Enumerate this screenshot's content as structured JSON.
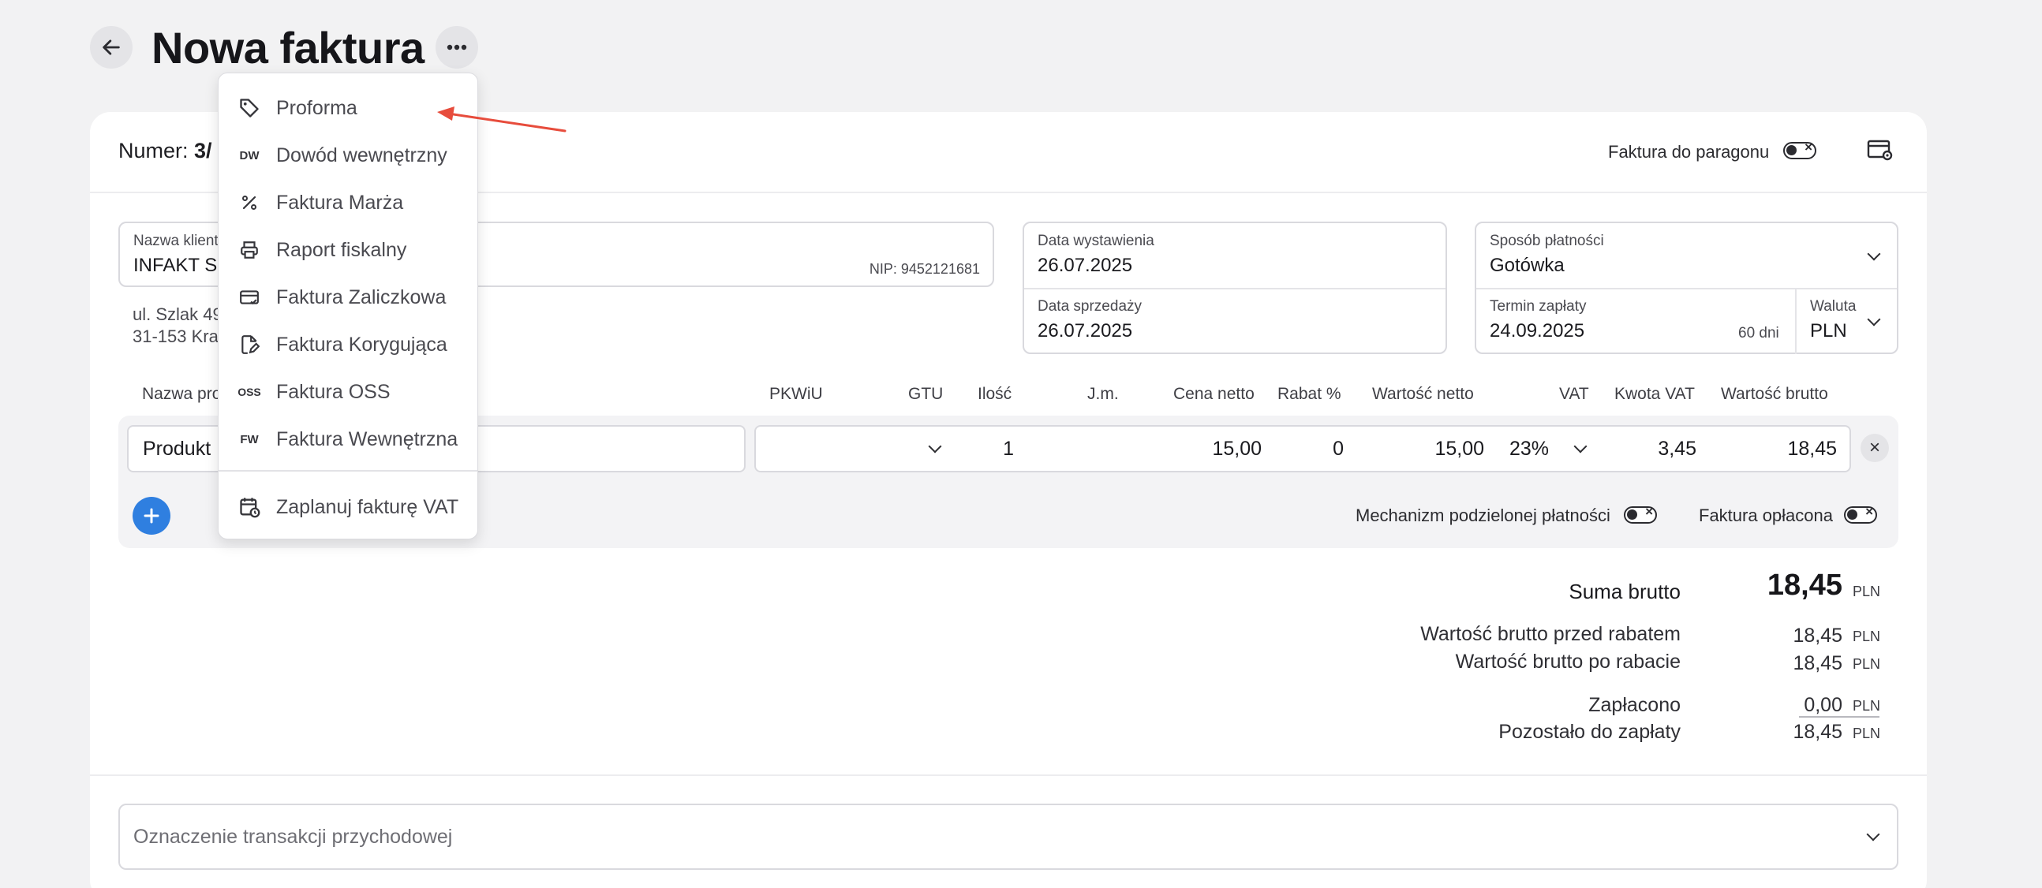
{
  "header": {
    "title": "Nowa faktura"
  },
  "card_head": {
    "numer_label": "Numer:",
    "numer_value": "3/",
    "receipt_toggle_label": "Faktura do paragonu"
  },
  "client": {
    "caption": "Nazwa klient",
    "name": "INFAKT S",
    "nip": "NIP: 9452121681",
    "address_line1": "ul. Szlak 49",
    "address_line2": "31-153 Krak"
  },
  "dates": {
    "issue_caption": "Data wystawienia",
    "issue_value": "26.07.2025",
    "sale_caption": "Data sprzedaży",
    "sale_value": "26.07.2025"
  },
  "payment": {
    "method_caption": "Sposób płatności",
    "method_value": "Gotówka",
    "due_caption": "Termin zapłaty",
    "due_value": "24.09.2025",
    "due_days": "60 dni",
    "currency_caption": "Waluta",
    "currency_value": "PLN"
  },
  "table": {
    "headers": {
      "name": "Nazwa pro",
      "pkwiu": "PKWiU",
      "gtu": "GTU",
      "qty": "Ilość",
      "unit": "J.m.",
      "net_price": "Cena netto",
      "discount": "Rabat %",
      "net_value": "Wartość netto",
      "vat": "VAT",
      "vat_amount": "Kwota VAT",
      "gross_value": "Wartość brutto"
    },
    "row": {
      "name": "Produkt",
      "pkwiu": "",
      "gtu": "",
      "qty": "1",
      "unit": "",
      "net_price": "15,00",
      "discount": "0",
      "net_value": "15,00",
      "vat": "23%",
      "vat_amount": "3,45",
      "gross_value": "18,45"
    },
    "split_payment_label": "Mechanizm podzielonej płatności",
    "paid_label": "Faktura opłacona"
  },
  "summary": {
    "gross_label": "Suma brutto",
    "gross_value": "18,45",
    "currency": "PLN",
    "before_discount_label": "Wartość brutto przed rabatem",
    "before_discount_value": "18,45",
    "after_discount_label": "Wartość brutto po rabacie",
    "after_discount_value": "18,45",
    "paid_label": "Zapłacono",
    "paid_value": "0,00",
    "remaining_label": "Pozostało do zapłaty",
    "remaining_value": "18,45"
  },
  "transaction_field": {
    "placeholder": "Oznaczenie transakcji przychodowej"
  },
  "menu": {
    "items": [
      {
        "label": "Proforma",
        "icon": "tag-icon"
      },
      {
        "label": "Dowód wewnętrzny",
        "icon": "DW"
      },
      {
        "label": "Faktura Marża",
        "icon": "percent-icon"
      },
      {
        "label": "Raport fiskalny",
        "icon": "printer-icon"
      },
      {
        "label": "Faktura Zaliczkowa",
        "icon": "card-check-icon"
      },
      {
        "label": "Faktura Korygująca",
        "icon": "file-edit-icon"
      },
      {
        "label": "Faktura OSS",
        "icon": "OSS"
      },
      {
        "label": "Faktura Wewnętrzna",
        "icon": "FW"
      },
      {
        "label": "Zaplanuj fakturę VAT",
        "icon": "calendar-clock-icon"
      }
    ]
  },
  "colors": {
    "accent_blue": "#2f7fe0",
    "annotation_arrow": "#e74c3c"
  }
}
